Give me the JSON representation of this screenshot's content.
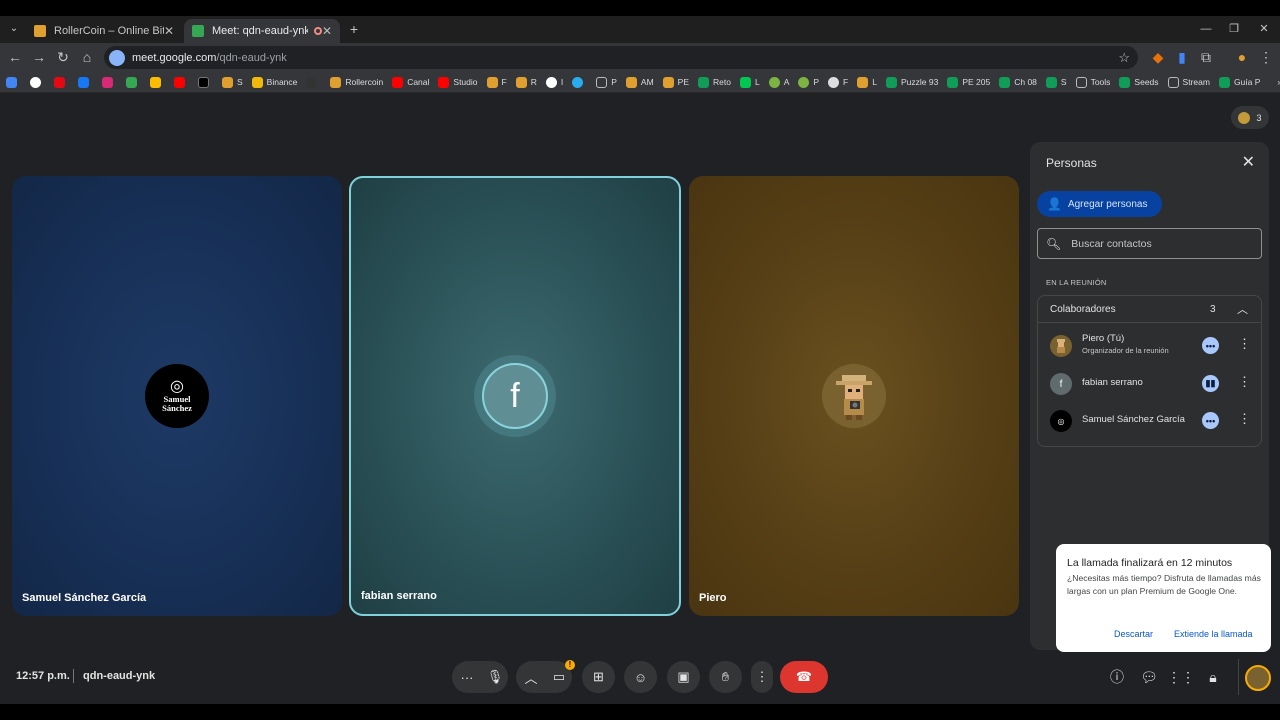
{
  "browser": {
    "tabs": [
      {
        "title": "RollerCoin – Online Bitcoin Mining",
        "active": false
      },
      {
        "title": "Meet: qdn-eaud-ynk",
        "active": true
      }
    ],
    "new_tab": "+",
    "url_host": "meet.google.com",
    "url_path": "/qdn-eaud-ynk",
    "bookmarks": [
      "S",
      "Binance",
      "Rollercoin",
      "Canal",
      "Studio",
      "F",
      "R",
      "I",
      "P",
      "AM",
      "PE",
      "Reto",
      "L",
      "A",
      "P",
      "F",
      "L",
      "Puzzle 93",
      "PE 205",
      "Ch 08",
      "S",
      "Tools",
      "Seeds",
      "Stream",
      "Guía P"
    ],
    "participants_badge": "3"
  },
  "tiles": [
    {
      "name": "Samuel Sánchez García",
      "avatar_text_line1": "Samuel",
      "avatar_text_line2": "Sánchez"
    },
    {
      "name": "fabian serrano",
      "avatar_letter": "f"
    },
    {
      "name": "Piero"
    }
  ],
  "panel": {
    "title": "Personas",
    "add_people": "Agregar personas",
    "search_placeholder": "Buscar contactos",
    "section_label": "EN LA REUNIÓN",
    "group_label": "Colaboradores",
    "group_count": "3",
    "people": [
      {
        "name": "Piero (Tú)",
        "subtitle": "Organizador de la reunión"
      },
      {
        "name": "fabian serrano",
        "avatar_letter": "f"
      },
      {
        "name": "Samuel Sánchez García"
      }
    ]
  },
  "notice": {
    "title": "La llamada finalizará en 12 minutos",
    "body": "¿Necesitas más tiempo? Disfruta de llamadas más largas con un plan Premium de Google One.",
    "dismiss": "Descartar",
    "extend": "Extiende la llamada"
  },
  "bottom": {
    "time": "12:57 p.m.",
    "meeting_code": "qdn-eaud-ynk"
  },
  "colors": {
    "accent": "#0842a0",
    "end_call": "#dc362e",
    "active_border": "#7fd1dc"
  }
}
